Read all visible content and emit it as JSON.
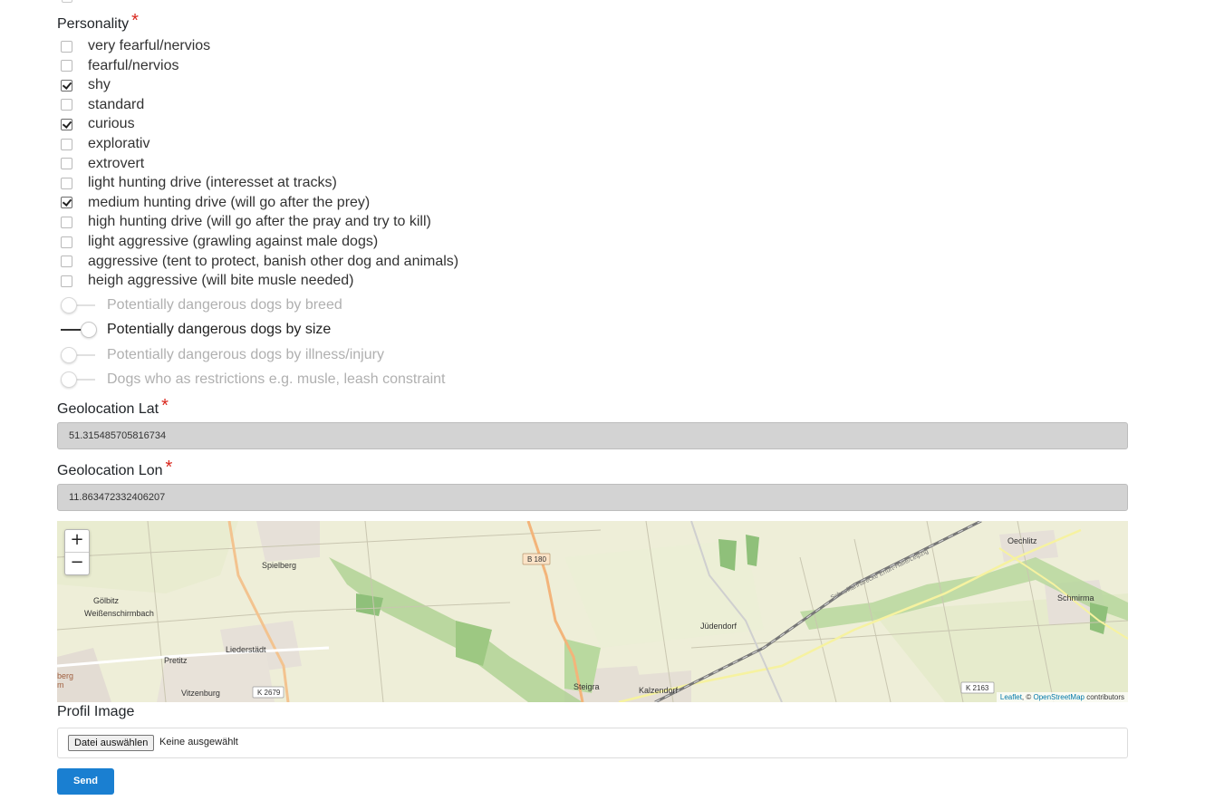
{
  "personality": {
    "title": "Personality",
    "required_mark": "*",
    "options": [
      {
        "label": "very fearful/nervios",
        "checked": false
      },
      {
        "label": "fearful/nervios",
        "checked": false
      },
      {
        "label": "shy",
        "checked": true
      },
      {
        "label": "standard",
        "checked": false
      },
      {
        "label": "curious",
        "checked": true
      },
      {
        "label": "explorativ",
        "checked": false
      },
      {
        "label": "extrovert",
        "checked": false
      },
      {
        "label": "light hunting drive (interesset at tracks)",
        "checked": false
      },
      {
        "label": "medium hunting drive (will go after the prey)",
        "checked": true
      },
      {
        "label": "high hunting drive (will go after the pray and try to kill)",
        "checked": false
      },
      {
        "label": "light aggressive (grawling against male dogs)",
        "checked": false
      },
      {
        "label": "aggressive (tent to protect, banish other dog and animals)",
        "checked": false
      },
      {
        "label": "heigh aggressive (will bite musle needed)",
        "checked": false
      }
    ]
  },
  "toggles": [
    {
      "label": "Potentially dangerous dogs by breed",
      "on": false
    },
    {
      "label": "Potentially dangerous dogs by size",
      "on": true
    },
    {
      "label": "Potentially dangerous dogs by illness/injury",
      "on": false
    },
    {
      "label": "Dogs who as restrictions e.g. musle, leash constraint",
      "on": false
    }
  ],
  "geo_lat": {
    "label": "Geolocation Lat",
    "required_mark": "*",
    "value": "51.315485705816734"
  },
  "geo_lon": {
    "label": "Geolocation Lon",
    "required_mark": "*",
    "value": "11.863472332406207"
  },
  "map": {
    "zoom_in": "+",
    "zoom_out": "−",
    "places": [
      "Spielberg",
      "Gölbitz",
      "Weißenschirmbach",
      "Liederstädt",
      "Pretitz",
      "Vitzenburg",
      "Steigra",
      "Kalzendorf",
      "Jüdendorf",
      "Oechlitz",
      "Schmirma",
      "berg",
      "m"
    ],
    "road_labels": [
      "B 180",
      "K 2679",
      "K 2163"
    ],
    "rail_label": "Schnellfahrstrecke Erfurt-Halle/Leipzig",
    "attribution": {
      "leaflet": "Leaflet",
      "sep": ", © ",
      "osm": "OpenStreetMap",
      "contrib": " contributors"
    }
  },
  "profile": {
    "label": "Profil Image",
    "button": "Datei auswählen",
    "status": "Keine ausgewählt"
  },
  "send_label": "Send",
  "colors": {
    "accent": "#1a7fd1",
    "required": "#d9261c",
    "readonly_bg": "#d3d3d3"
  }
}
